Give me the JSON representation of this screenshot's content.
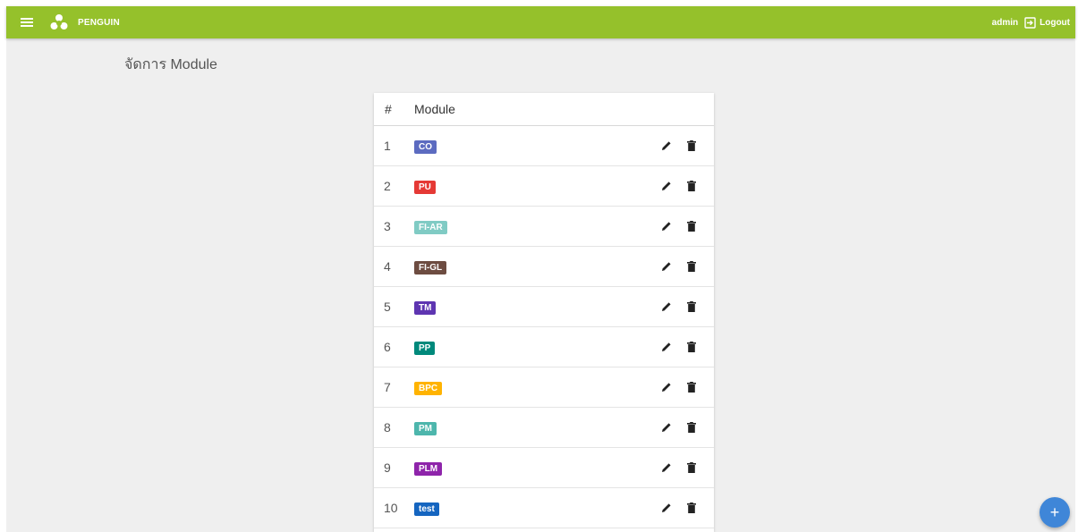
{
  "app": {
    "brand": "PENGUIN"
  },
  "header": {
    "user": "admin",
    "logout_label": "Logout"
  },
  "page": {
    "title": "จัดการ Module"
  },
  "table": {
    "columns": [
      "#",
      "Module"
    ],
    "rows": [
      {
        "num": "1",
        "module": "CO",
        "color": "#5c6bc0"
      },
      {
        "num": "2",
        "module": "PU",
        "color": "#e53935"
      },
      {
        "num": "3",
        "module": "FI-AR",
        "color": "#80cbc4"
      },
      {
        "num": "4",
        "module": "FI-GL",
        "color": "#6d4c41"
      },
      {
        "num": "5",
        "module": "TM",
        "color": "#5e35b1"
      },
      {
        "num": "6",
        "module": "PP",
        "color": "#00897b"
      },
      {
        "num": "7",
        "module": "BPC",
        "color": "#ffb300"
      },
      {
        "num": "8",
        "module": "PM",
        "color": "#4db6ac"
      },
      {
        "num": "9",
        "module": "PLM",
        "color": "#8e24aa"
      },
      {
        "num": "10",
        "module": "test",
        "color": "#1565c0"
      }
    ]
  },
  "fab": {
    "label": "+"
  },
  "icons": [
    "menu-icon",
    "penguin-logo-icon",
    "logout-icon",
    "edit-icon",
    "delete-icon",
    "add-icon"
  ],
  "colors": {
    "topbar": "#95c12b",
    "background": "#efefef",
    "fab": "#3f86d8"
  }
}
